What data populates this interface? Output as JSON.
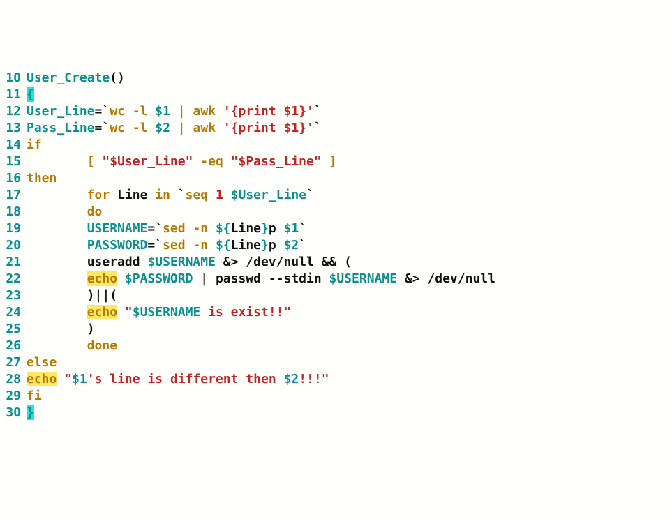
{
  "lines": [
    {
      "n": "10",
      "tokens": [
        {
          "t": "User_Create",
          "c": "teal"
        },
        {
          "t": "()",
          "c": "black"
        }
      ]
    },
    {
      "n": "11",
      "tokens": [
        {
          "t": "{",
          "c": "hl-c"
        }
      ]
    },
    {
      "n": "12",
      "tokens": [
        {
          "t": "User_Line",
          "c": "teal"
        },
        {
          "t": "=`",
          "c": "black"
        },
        {
          "t": "wc -l",
          "c": "orange"
        },
        {
          "t": " ",
          "c": "black"
        },
        {
          "t": "$1",
          "c": "teal"
        },
        {
          "t": " ",
          "c": "black"
        },
        {
          "t": "| ",
          "c": "orange"
        },
        {
          "t": "awk ",
          "c": "orange"
        },
        {
          "t": "'{print $1}'",
          "c": "red"
        },
        {
          "t": "`",
          "c": "black"
        }
      ]
    },
    {
      "n": "13",
      "tokens": [
        {
          "t": "Pass_Line",
          "c": "teal"
        },
        {
          "t": "=`",
          "c": "black"
        },
        {
          "t": "wc -l",
          "c": "orange"
        },
        {
          "t": " ",
          "c": "black"
        },
        {
          "t": "$2",
          "c": "teal"
        },
        {
          "t": " ",
          "c": "black"
        },
        {
          "t": "| ",
          "c": "orange"
        },
        {
          "t": "awk ",
          "c": "orange"
        },
        {
          "t": "'{print $1}'",
          "c": "red"
        },
        {
          "t": "`",
          "c": "black"
        }
      ]
    },
    {
      "n": "14",
      "tokens": [
        {
          "t": "if",
          "c": "orange"
        }
      ]
    },
    {
      "n": "15",
      "tokens": [
        {
          "t": "        ",
          "c": "black"
        },
        {
          "t": "[ ",
          "c": "orange"
        },
        {
          "t": "\"$User_Line\"",
          "c": "red"
        },
        {
          "t": " ",
          "c": "black"
        },
        {
          "t": "-eq ",
          "c": "orange"
        },
        {
          "t": "\"$Pass_Line\"",
          "c": "red"
        },
        {
          "t": " ",
          "c": "black"
        },
        {
          "t": "]",
          "c": "orange"
        }
      ]
    },
    {
      "n": "16",
      "tokens": [
        {
          "t": "then",
          "c": "orange"
        }
      ]
    },
    {
      "n": "17",
      "tokens": [
        {
          "t": "        ",
          "c": "black"
        },
        {
          "t": "for ",
          "c": "orange"
        },
        {
          "t": "Line ",
          "c": "black"
        },
        {
          "t": "in ",
          "c": "orange"
        },
        {
          "t": "`",
          "c": "black"
        },
        {
          "t": "seq ",
          "c": "orange"
        },
        {
          "t": "1 ",
          "c": "red"
        },
        {
          "t": "$User_Line",
          "c": "teal"
        },
        {
          "t": "`",
          "c": "black"
        }
      ]
    },
    {
      "n": "18",
      "tokens": [
        {
          "t": "        ",
          "c": "black"
        },
        {
          "t": "do",
          "c": "orange"
        }
      ]
    },
    {
      "n": "19",
      "tokens": [
        {
          "t": "        ",
          "c": "black"
        },
        {
          "t": "USERNAME",
          "c": "teal"
        },
        {
          "t": "=`",
          "c": "black"
        },
        {
          "t": "sed -n ",
          "c": "orange"
        },
        {
          "t": "${",
          "c": "teal"
        },
        {
          "t": "Line",
          "c": "black"
        },
        {
          "t": "}",
          "c": "teal"
        },
        {
          "t": "p ",
          "c": "black"
        },
        {
          "t": "$1",
          "c": "teal"
        },
        {
          "t": "`",
          "c": "black"
        }
      ]
    },
    {
      "n": "20",
      "tokens": [
        {
          "t": "        ",
          "c": "black"
        },
        {
          "t": "PASSWORD",
          "c": "teal"
        },
        {
          "t": "=`",
          "c": "black"
        },
        {
          "t": "sed -n ",
          "c": "orange"
        },
        {
          "t": "${",
          "c": "teal"
        },
        {
          "t": "Line",
          "c": "black"
        },
        {
          "t": "}",
          "c": "teal"
        },
        {
          "t": "p ",
          "c": "black"
        },
        {
          "t": "$2",
          "c": "teal"
        },
        {
          "t": "`",
          "c": "black"
        }
      ]
    },
    {
      "n": "21",
      "tokens": [
        {
          "t": "        ",
          "c": "black"
        },
        {
          "t": "useradd ",
          "c": "black"
        },
        {
          "t": "$USERNAME",
          "c": "teal"
        },
        {
          "t": " &> /dev/null && (",
          "c": "black"
        }
      ]
    },
    {
      "n": "22",
      "tokens": [
        {
          "t": "        ",
          "c": "black"
        },
        {
          "t": "echo",
          "c": "hl-y"
        },
        {
          "t": " ",
          "c": "black"
        },
        {
          "t": "$PASSWORD",
          "c": "teal"
        },
        {
          "t": " | passwd --stdin ",
          "c": "black"
        },
        {
          "t": "$USERNAME",
          "c": "teal"
        },
        {
          "t": " &> /dev/null",
          "c": "black"
        }
      ]
    },
    {
      "n": "23",
      "tokens": [
        {
          "t": "        ",
          "c": "black"
        },
        {
          "t": ")||(",
          "c": "black"
        }
      ]
    },
    {
      "n": "24",
      "tokens": [
        {
          "t": "        ",
          "c": "black"
        },
        {
          "t": "echo",
          "c": "hl-y"
        },
        {
          "t": " ",
          "c": "black"
        },
        {
          "t": "\"",
          "c": "red"
        },
        {
          "t": "$USERNAME",
          "c": "teal"
        },
        {
          "t": " is exist!!\"",
          "c": "red"
        }
      ]
    },
    {
      "n": "25",
      "tokens": [
        {
          "t": "        ",
          "c": "black"
        },
        {
          "t": ")",
          "c": "black"
        }
      ]
    },
    {
      "n": "26",
      "tokens": [
        {
          "t": "        ",
          "c": "black"
        },
        {
          "t": "done",
          "c": "orange"
        }
      ]
    },
    {
      "n": "27",
      "tokens": [
        {
          "t": "else",
          "c": "orange"
        }
      ]
    },
    {
      "n": "28",
      "tokens": [
        {
          "t": "echo",
          "c": "hl-y"
        },
        {
          "t": " ",
          "c": "black"
        },
        {
          "t": "\"",
          "c": "red"
        },
        {
          "t": "$1",
          "c": "teal"
        },
        {
          "t": "'s line is different then ",
          "c": "red"
        },
        {
          "t": "$2",
          "c": "teal"
        },
        {
          "t": "!!!\"",
          "c": "red"
        }
      ]
    },
    {
      "n": "29",
      "tokens": [
        {
          "t": "fi",
          "c": "orange"
        }
      ]
    },
    {
      "n": "30",
      "tokens": [
        {
          "t": "}",
          "c": "hl-c"
        }
      ]
    }
  ]
}
